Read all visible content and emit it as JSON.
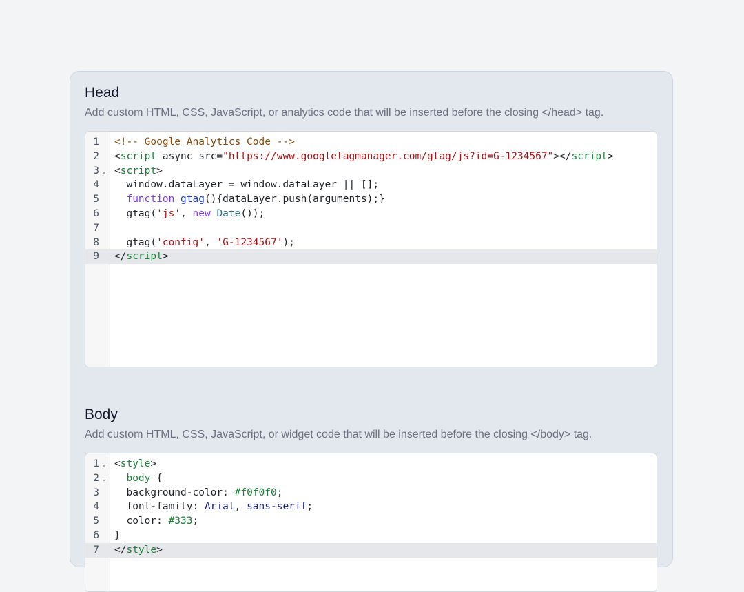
{
  "head": {
    "title": "Head",
    "description": "Add custom HTML, CSS, JavaScript, or analytics code that will be inserted before the closing </head> tag.",
    "lines": [
      {
        "n": "1",
        "fold": "",
        "tokens": [
          [
            "comment",
            "<!-- Google Analytics Code -->"
          ]
        ]
      },
      {
        "n": "2",
        "fold": "",
        "tokens": [
          [
            "plain",
            "<"
          ],
          [
            "tag",
            "script"
          ],
          [
            "plain",
            " async src="
          ],
          [
            "str",
            "\"https://www.googletagmanager.com/gtag/js?id=G-1234567\""
          ],
          [
            "plain",
            "></"
          ],
          [
            "tag",
            "script"
          ],
          [
            "plain",
            ">"
          ]
        ]
      },
      {
        "n": "3",
        "fold": "⌄",
        "tokens": [
          [
            "plain",
            "<"
          ],
          [
            "tag",
            "script"
          ],
          [
            "plain",
            ">"
          ]
        ]
      },
      {
        "n": "4",
        "fold": "",
        "tokens": [
          [
            "plain",
            "  window.dataLayer = window.dataLayer || [];"
          ]
        ]
      },
      {
        "n": "5",
        "fold": "",
        "tokens": [
          [
            "plain",
            "  "
          ],
          [
            "kw",
            "function"
          ],
          [
            "plain",
            " "
          ],
          [
            "fn",
            "gtag"
          ],
          [
            "plain",
            "(){dataLayer.push(arguments);}"
          ]
        ]
      },
      {
        "n": "6",
        "fold": "",
        "tokens": [
          [
            "plain",
            "  gtag("
          ],
          [
            "str",
            "'js'"
          ],
          [
            "plain",
            ", "
          ],
          [
            "kw",
            "new"
          ],
          [
            "plain",
            " "
          ],
          [
            "type",
            "Date"
          ],
          [
            "plain",
            "());"
          ]
        ]
      },
      {
        "n": "7",
        "fold": "",
        "tokens": []
      },
      {
        "n": "8",
        "fold": "",
        "tokens": [
          [
            "plain",
            "  gtag("
          ],
          [
            "str",
            "'config'"
          ],
          [
            "plain",
            ", "
          ],
          [
            "str",
            "'G-1234567'"
          ],
          [
            "plain",
            ");"
          ]
        ]
      },
      {
        "n": "9",
        "fold": "",
        "active": true,
        "tokens": [
          [
            "plain",
            "</"
          ],
          [
            "tag",
            "script"
          ],
          [
            "plain",
            ">"
          ]
        ]
      }
    ]
  },
  "body": {
    "title": "Body",
    "description": "Add custom HTML, CSS, JavaScript, or widget code that will be inserted before the closing </body> tag.",
    "lines": [
      {
        "n": "1",
        "fold": "⌄",
        "tokens": [
          [
            "plain",
            "<"
          ],
          [
            "tag",
            "style"
          ],
          [
            "plain",
            ">"
          ]
        ]
      },
      {
        "n": "2",
        "fold": "⌄",
        "tokens": [
          [
            "plain",
            "  "
          ],
          [
            "tag",
            "body"
          ],
          [
            "plain",
            " {"
          ]
        ]
      },
      {
        "n": "3",
        "fold": "",
        "tokens": [
          [
            "plain",
            "  background-color: "
          ],
          [
            "num",
            "#f0f0f0"
          ],
          [
            "plain",
            ";"
          ]
        ]
      },
      {
        "n": "4",
        "fold": "",
        "tokens": [
          [
            "plain",
            "  font-family: "
          ],
          [
            "ident",
            "Arial"
          ],
          [
            "plain",
            ", "
          ],
          [
            "ident",
            "sans-serif"
          ],
          [
            "plain",
            ";"
          ]
        ]
      },
      {
        "n": "5",
        "fold": "",
        "tokens": [
          [
            "plain",
            "  color: "
          ],
          [
            "num",
            "#333"
          ],
          [
            "plain",
            ";"
          ]
        ]
      },
      {
        "n": "6",
        "fold": "",
        "tokens": [
          [
            "plain",
            "}"
          ]
        ]
      },
      {
        "n": "7",
        "fold": "",
        "active": true,
        "tokens": [
          [
            "plain",
            "</"
          ],
          [
            "tag",
            "style"
          ],
          [
            "plain",
            ">"
          ]
        ]
      }
    ]
  }
}
